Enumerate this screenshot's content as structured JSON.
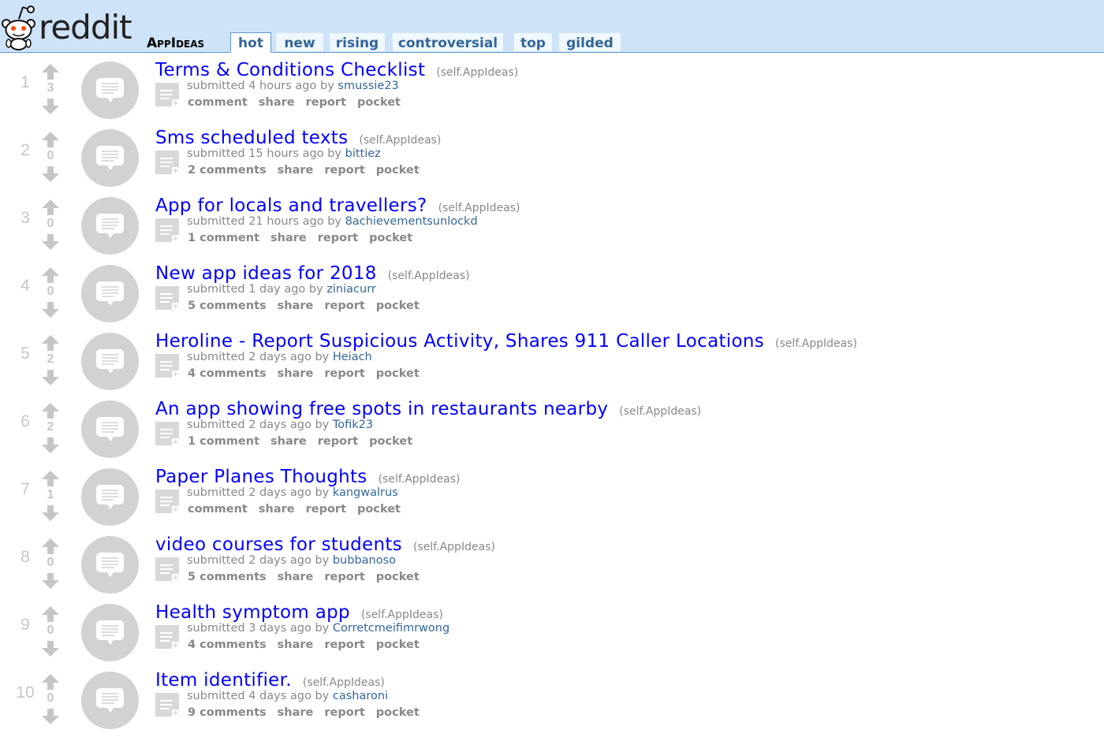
{
  "header": {
    "logo_text": "reddit",
    "subreddit": "AppIdeas",
    "tabs": [
      {
        "label": "hot",
        "selected": true
      },
      {
        "label": "new",
        "selected": false
      },
      {
        "label": "rising",
        "selected": false
      },
      {
        "label": "controversial",
        "selected": false
      },
      {
        "label": "top",
        "selected": false
      },
      {
        "label": "gilded",
        "selected": false
      }
    ]
  },
  "colors": {
    "header_bg": "#cee3f8",
    "link": "#0000ff",
    "author": "#336699",
    "muted": "#888888"
  },
  "posts": [
    {
      "rank": "1",
      "score": "3",
      "title": "Terms & Conditions Checklist",
      "domain": "(self.AppIdeas)",
      "submitted": "submitted 4 hours ago by",
      "author": "smussie23",
      "comments": "comment",
      "share": "share",
      "report": "report",
      "pocket": "pocket"
    },
    {
      "rank": "2",
      "score": "0",
      "title": "Sms scheduled texts",
      "domain": "(self.AppIdeas)",
      "submitted": "submitted 15 hours ago by",
      "author": "bittiez",
      "comments": "2 comments",
      "share": "share",
      "report": "report",
      "pocket": "pocket"
    },
    {
      "rank": "3",
      "score": "0",
      "title": "App for locals and travellers?",
      "domain": "(self.AppIdeas)",
      "submitted": "submitted 21 hours ago by",
      "author": "8achievementsunlockd",
      "comments": "1 comment",
      "share": "share",
      "report": "report",
      "pocket": "pocket"
    },
    {
      "rank": "4",
      "score": "0",
      "title": "New app ideas for 2018",
      "domain": "(self.AppIdeas)",
      "submitted": "submitted 1 day ago by",
      "author": "ziniacurr",
      "comments": "5 comments",
      "share": "share",
      "report": "report",
      "pocket": "pocket"
    },
    {
      "rank": "5",
      "score": "2",
      "title": "Heroline - Report Suspicious Activity, Shares 911 Caller Locations",
      "domain": "(self.AppIdeas)",
      "submitted": "submitted 2 days ago by",
      "author": "Heiach",
      "comments": "4 comments",
      "share": "share",
      "report": "report",
      "pocket": "pocket"
    },
    {
      "rank": "6",
      "score": "2",
      "title": "An app showing free spots in restaurants nearby",
      "domain": "(self.AppIdeas)",
      "submitted": "submitted 2 days ago by",
      "author": "Tofik23",
      "comments": "1 comment",
      "share": "share",
      "report": "report",
      "pocket": "pocket"
    },
    {
      "rank": "7",
      "score": "1",
      "title": "Paper Planes Thoughts",
      "domain": "(self.AppIdeas)",
      "submitted": "submitted 2 days ago by",
      "author": "kangwalrus",
      "comments": "comment",
      "share": "share",
      "report": "report",
      "pocket": "pocket"
    },
    {
      "rank": "8",
      "score": "0",
      "title": "video courses for students",
      "domain": "(self.AppIdeas)",
      "submitted": "submitted 2 days ago by",
      "author": "bubbanoso",
      "comments": "5 comments",
      "share": "share",
      "report": "report",
      "pocket": "pocket"
    },
    {
      "rank": "9",
      "score": "0",
      "title": "Health symptom app",
      "domain": "(self.AppIdeas)",
      "submitted": "submitted 3 days ago by",
      "author": "Corretcmeifimrwong",
      "comments": "4 comments",
      "share": "share",
      "report": "report",
      "pocket": "pocket"
    },
    {
      "rank": "10",
      "score": "0",
      "title": "Item identifier.",
      "domain": "(self.AppIdeas)",
      "submitted": "submitted 4 days ago by",
      "author": "casharoni",
      "comments": "9 comments",
      "share": "share",
      "report": "report",
      "pocket": "pocket"
    }
  ]
}
